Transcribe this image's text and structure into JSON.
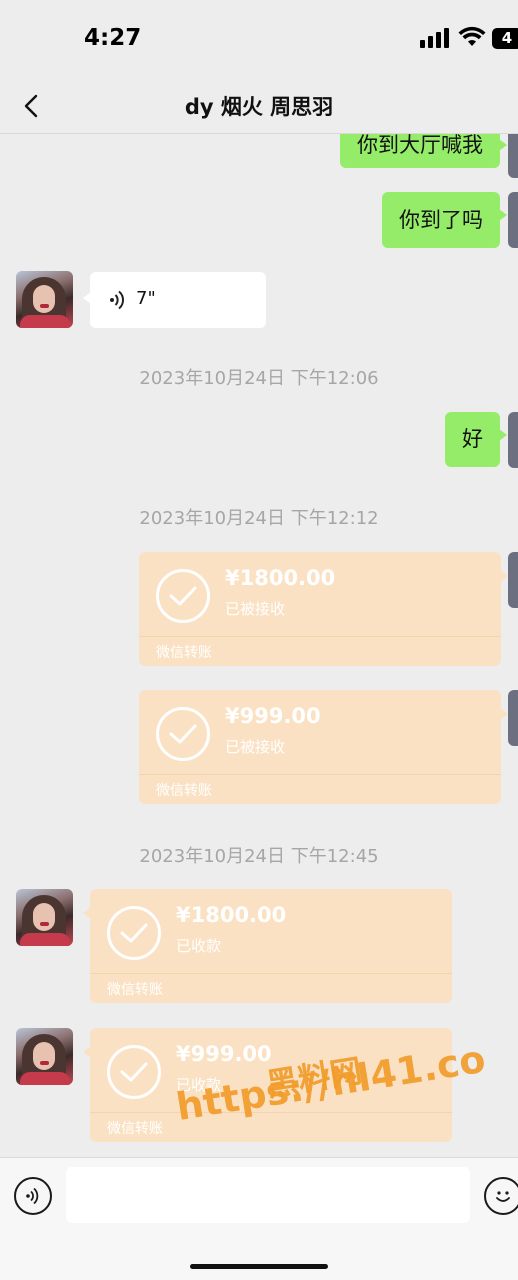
{
  "status_bar": {
    "time": "4:27",
    "battery": "4"
  },
  "header": {
    "title": "dy 烟火 周思羽",
    "back_icon": "chevron-left-icon"
  },
  "messages": {
    "sent_1": "你到大厅喊我",
    "sent_2": "你到了吗",
    "voice": {
      "duration": "7\""
    },
    "time_1": "2023年10月24日 下午12:06",
    "sent_3": "好",
    "time_2": "2023年10月24日 下午12:12",
    "transfer_out_1": {
      "amount": "¥1800.00",
      "status": "已被接收",
      "source": "微信转账"
    },
    "transfer_out_2": {
      "amount": "¥999.00",
      "status": "已被接收",
      "source": "微信转账"
    },
    "time_3": "2023年10月24日 下午12:45",
    "transfer_in_1": {
      "amount": "¥1800.00",
      "status": "已收款",
      "source": "微信转账"
    },
    "transfer_in_2": {
      "amount": "¥999.00",
      "status": "已收款",
      "source": "微信转账"
    }
  },
  "watermark": {
    "name": "黑料网",
    "url": "https://hl41.co"
  },
  "input_bar": {
    "placeholder": "",
    "voice_icon": "voice-icon",
    "emoji_icon": "emoji-icon"
  },
  "colors": {
    "background": "#ededed",
    "sent_bubble": "#95ec69",
    "transfer_card": "#fbe1c3",
    "watermark": "#f29c2c"
  }
}
